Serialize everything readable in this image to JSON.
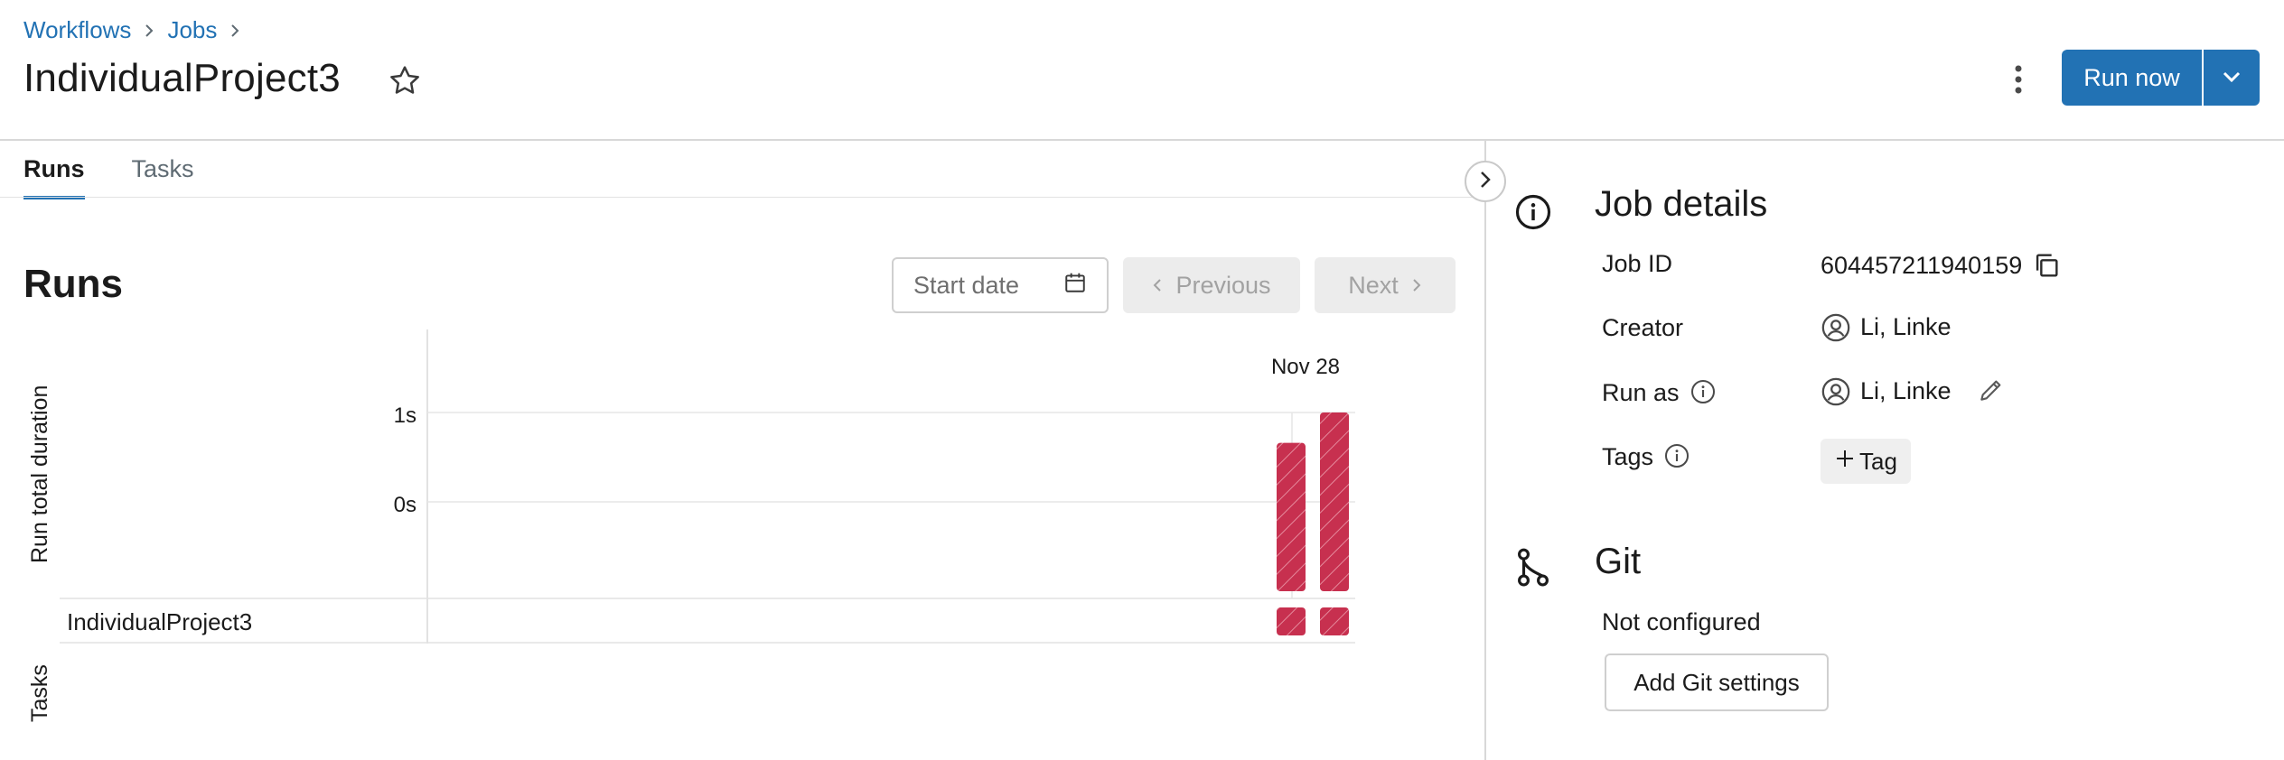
{
  "breadcrumb": [
    "Workflows",
    "Jobs"
  ],
  "page_title": "IndividualProject3",
  "header": {
    "run_now_label": "Run now"
  },
  "tabs": [
    {
      "label": "Runs",
      "active": true
    },
    {
      "label": "Tasks",
      "active": false
    }
  ],
  "runs": {
    "heading": "Runs",
    "start_date_placeholder": "Start date",
    "previous_label": "Previous",
    "next_label": "Next"
  },
  "chart_data": {
    "type": "bar",
    "x_label": "Nov 28",
    "ylabel": "Run total duration",
    "yticks": [
      "1s",
      "0s"
    ],
    "bar_color": "#c7304f",
    "values_fraction_of_1s": [
      0.83,
      1.0
    ],
    "task_row": "IndividualProject3",
    "task_row_label": "Tasks"
  },
  "job_details": {
    "heading": "Job details",
    "job_id_label": "Job ID",
    "job_id": "604457211940159",
    "creator_label": "Creator",
    "creator": "Li, Linke",
    "run_as_label": "Run as",
    "run_as": "Li, Linke",
    "tags_label": "Tags",
    "tag_button_label": "Tag"
  },
  "git": {
    "heading": "Git",
    "status": "Not configured",
    "button_label": "Add Git settings"
  },
  "colors": {
    "accent": "#2272b4",
    "bar": "#c7304f"
  }
}
